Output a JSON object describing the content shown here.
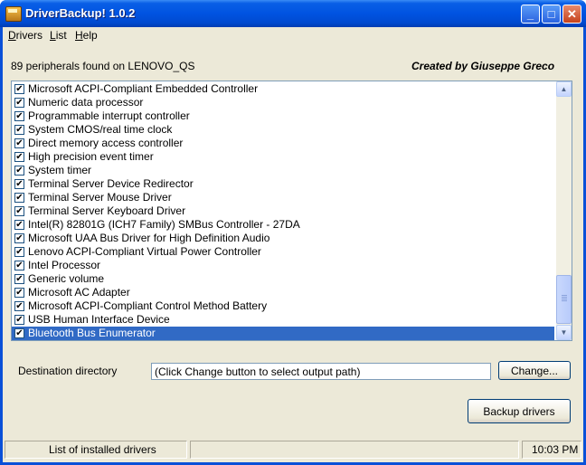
{
  "window": {
    "title": "DriverBackup! 1.0.2"
  },
  "menu": [
    "Drivers",
    "List",
    "Help"
  ],
  "menu_accel": [
    "D",
    "L",
    "H"
  ],
  "header": {
    "found_text": "89 peripherals found on LENOVO_QS",
    "credit": "Created by Giuseppe Greco"
  },
  "drivers": [
    {
      "label": "Microsoft ACPI-Compliant Embedded Controller",
      "checked": true
    },
    {
      "label": "Numeric data processor",
      "checked": true
    },
    {
      "label": "Programmable interrupt controller",
      "checked": true
    },
    {
      "label": "System CMOS/real time clock",
      "checked": true
    },
    {
      "label": "Direct memory access controller",
      "checked": true
    },
    {
      "label": "High precision event timer",
      "checked": true
    },
    {
      "label": "System timer",
      "checked": true
    },
    {
      "label": "Terminal Server Device Redirector",
      "checked": true
    },
    {
      "label": "Terminal Server Mouse Driver",
      "checked": true
    },
    {
      "label": "Terminal Server Keyboard Driver",
      "checked": true
    },
    {
      "label": "Intel(R) 82801G (ICH7 Family) SMBus Controller - 27DA",
      "checked": true
    },
    {
      "label": "Microsoft UAA Bus Driver for High Definition Audio",
      "checked": true
    },
    {
      "label": "Lenovo ACPI-Compliant Virtual Power Controller",
      "checked": true
    },
    {
      "label": "Intel Processor",
      "checked": true
    },
    {
      "label": "Generic volume",
      "checked": true
    },
    {
      "label": "Microsoft AC Adapter",
      "checked": true
    },
    {
      "label": "Microsoft ACPI-Compliant Control Method Battery",
      "checked": true
    },
    {
      "label": "USB Human Interface Device",
      "checked": true
    },
    {
      "label": "Bluetooth Bus Enumerator",
      "checked": true,
      "selected": true
    }
  ],
  "destination": {
    "label": "Destination directory",
    "value": "(Click Change button to select output path)",
    "change_button": "Change..."
  },
  "backup_button": "Backup drivers",
  "status": {
    "left": "List of installed drivers",
    "middle": "",
    "time": "10:03 PM"
  },
  "colors": {
    "title_bar": "#0053e1",
    "selection": "#316ac5",
    "face": "#ece9d8"
  },
  "icons": [
    "app-icon",
    "minimize-icon",
    "maximize-icon",
    "close-icon",
    "scroll-up-icon",
    "scroll-down-icon",
    "check-icon"
  ]
}
